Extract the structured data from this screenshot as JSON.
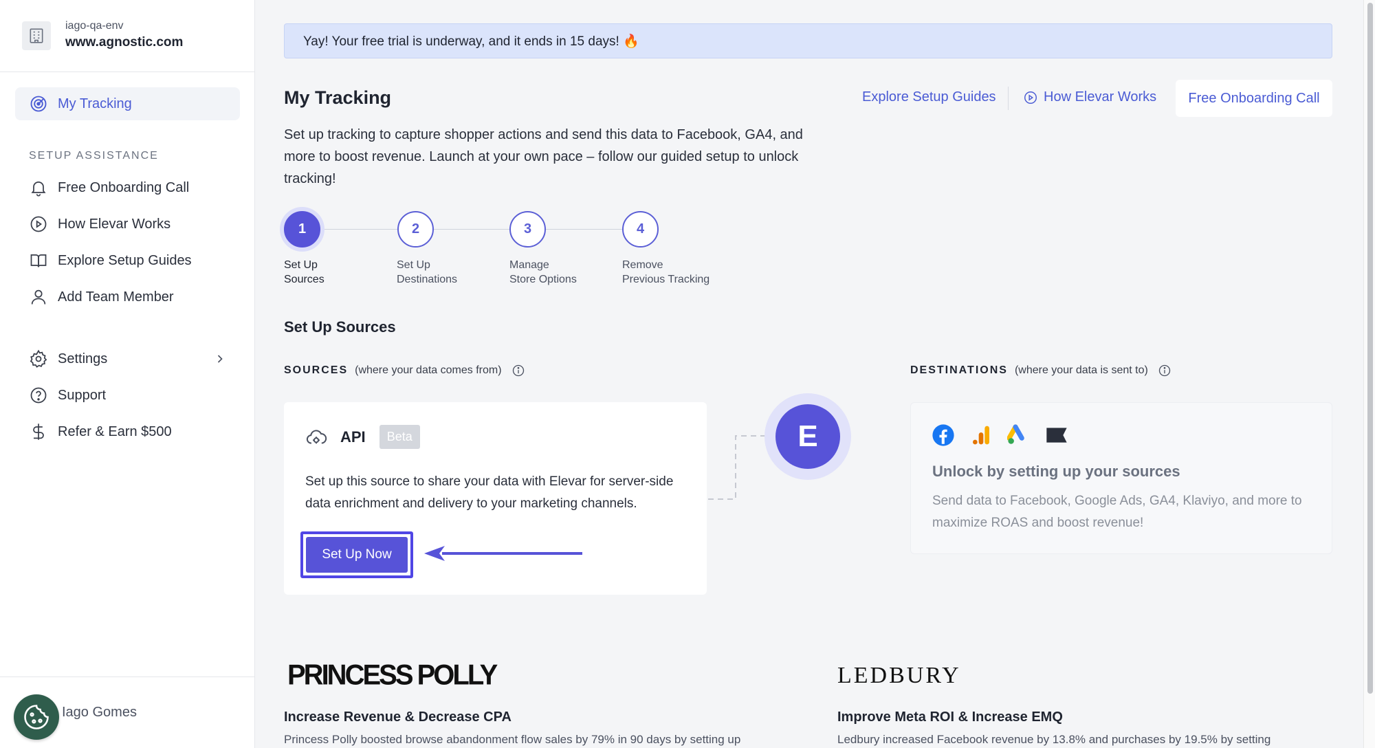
{
  "workspace": {
    "env": "iago-qa-env",
    "url": "www.agnostic.com"
  },
  "sidebar": {
    "active_item": "My Tracking",
    "section_title": "SETUP ASSISTANCE",
    "items": [
      {
        "label": "Free Onboarding Call",
        "icon": "bell-icon"
      },
      {
        "label": "How Elevar Works",
        "icon": "play-circle-icon"
      },
      {
        "label": "Explore Setup Guides",
        "icon": "book-icon"
      },
      {
        "label": "Add Team Member",
        "icon": "user-icon"
      }
    ],
    "bottom_items": [
      {
        "label": "Settings",
        "icon": "gear-icon"
      },
      {
        "label": "Support",
        "icon": "question-circle-icon"
      },
      {
        "label": "Refer & Earn $500",
        "icon": "dollar-icon"
      }
    ],
    "user_name": "Iago Gomes"
  },
  "banner": {
    "text": "Yay! Your free trial is underway, and it ends in 15 days! 🔥"
  },
  "header": {
    "title": "My Tracking",
    "links": {
      "guides": "Explore Setup Guides",
      "how": "How Elevar Works"
    },
    "cta": "Free Onboarding Call"
  },
  "intro": "Set up tracking to capture shopper actions and send this data to Facebook, GA4, and more to boost revenue. Launch at your own pace – follow our guided setup to unlock tracking!",
  "steps": [
    {
      "num": "1",
      "line1": "Set Up",
      "line2": "Sources"
    },
    {
      "num": "2",
      "line1": "Set Up",
      "line2": "Destinations"
    },
    {
      "num": "3",
      "line1": "Manage",
      "line2": "Store Options"
    },
    {
      "num": "4",
      "line1": "Remove",
      "line2": "Previous Tracking"
    }
  ],
  "section_title": "Set Up Sources",
  "sources": {
    "heading": "SOURCES",
    "sub": "(where your data comes from)",
    "api_name": "API",
    "badge": "Beta",
    "description": "Set up this source to share your data with Elevar for server-side data enrichment and delivery to your marketing channels.",
    "button": "Set Up Now"
  },
  "hub_letter": "E",
  "destinations": {
    "heading": "DESTINATIONS",
    "sub": "(where your data is sent to)",
    "title": "Unlock by setting up your sources",
    "description": "Send data to Facebook, Google Ads, GA4, Klaviyo, and more to maximize ROAS and boost revenue!"
  },
  "cases": [
    {
      "logo": "PRINCESS POLLY",
      "title": "Increase Revenue & Decrease CPA",
      "text": "Princess Polly boosted browse abandonment flow sales by 79% in 90 days by setting up"
    },
    {
      "logo": "LEDBURY",
      "title": "Improve Meta ROI & Increase EMQ",
      "text": "Ledbury increased Facebook revenue by 13.8% and purchases by 19.5% by setting"
    }
  ],
  "colors": {
    "accent": "#5753d8",
    "link": "#4a5bd4",
    "banner": "#dbe4fb"
  }
}
